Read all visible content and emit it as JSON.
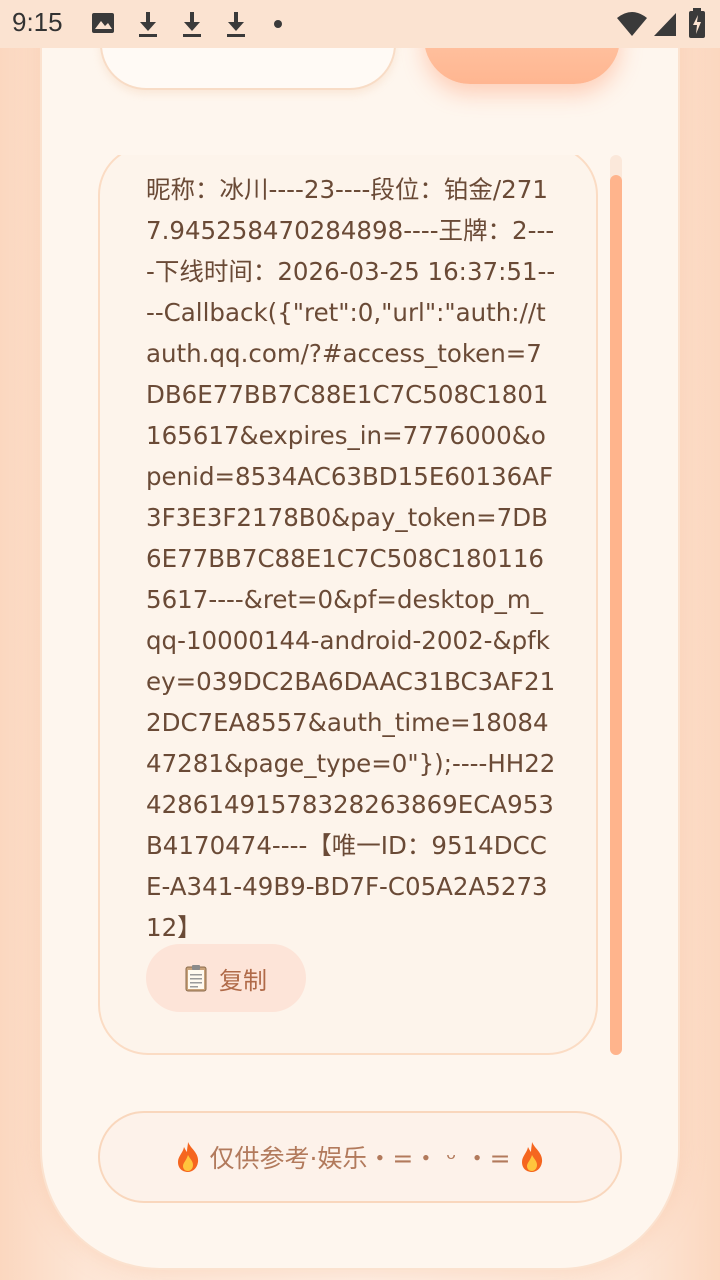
{
  "status_bar": {
    "time": "9:15",
    "left_icons": [
      "image-icon",
      "download-icon",
      "download-icon",
      "download-icon",
      "dot-icon"
    ],
    "right_icons": [
      "wifi-icon",
      "signal-icon",
      "battery-charging-icon"
    ]
  },
  "result": {
    "text": "昵称：冰川----23----段位：铂金/2717.945258470284898----王牌：2----下线时间：2026-03-25 16:37:51----Callback({\"ret\":0,\"url\":\"auth://tauth.qq.com/?#access_token=7DB6E77BB7C88E1C7C508C1801165617&expires_in=7776000&openid=8534AC63BD15E60136AF3F3E3F2178B0&pay_token=7DB6E77BB7C88E1C7C508C1801165617----&ret=0&pf=desktop_m_qq-10000144-android-2002-&pfkey=039DC2BA6DAAC31BC3AF212DC7EA8557&auth_time=1808447281&page_type=0\"});----HH2242861491578328263869ECA953B4170474----【唯一ID：9514DCCE-A341-49B9-BD7F-C05A2A527312】",
    "copy_label": "复制",
    "copy_icon": "clipboard-icon"
  },
  "footer": {
    "label": "仅供参考·娱乐・=・ ᵕ ・=",
    "icon": "fire-icon"
  },
  "colors": {
    "accent": "#ffb48c",
    "text": "#6a4a36",
    "background": "#fef6ee"
  }
}
